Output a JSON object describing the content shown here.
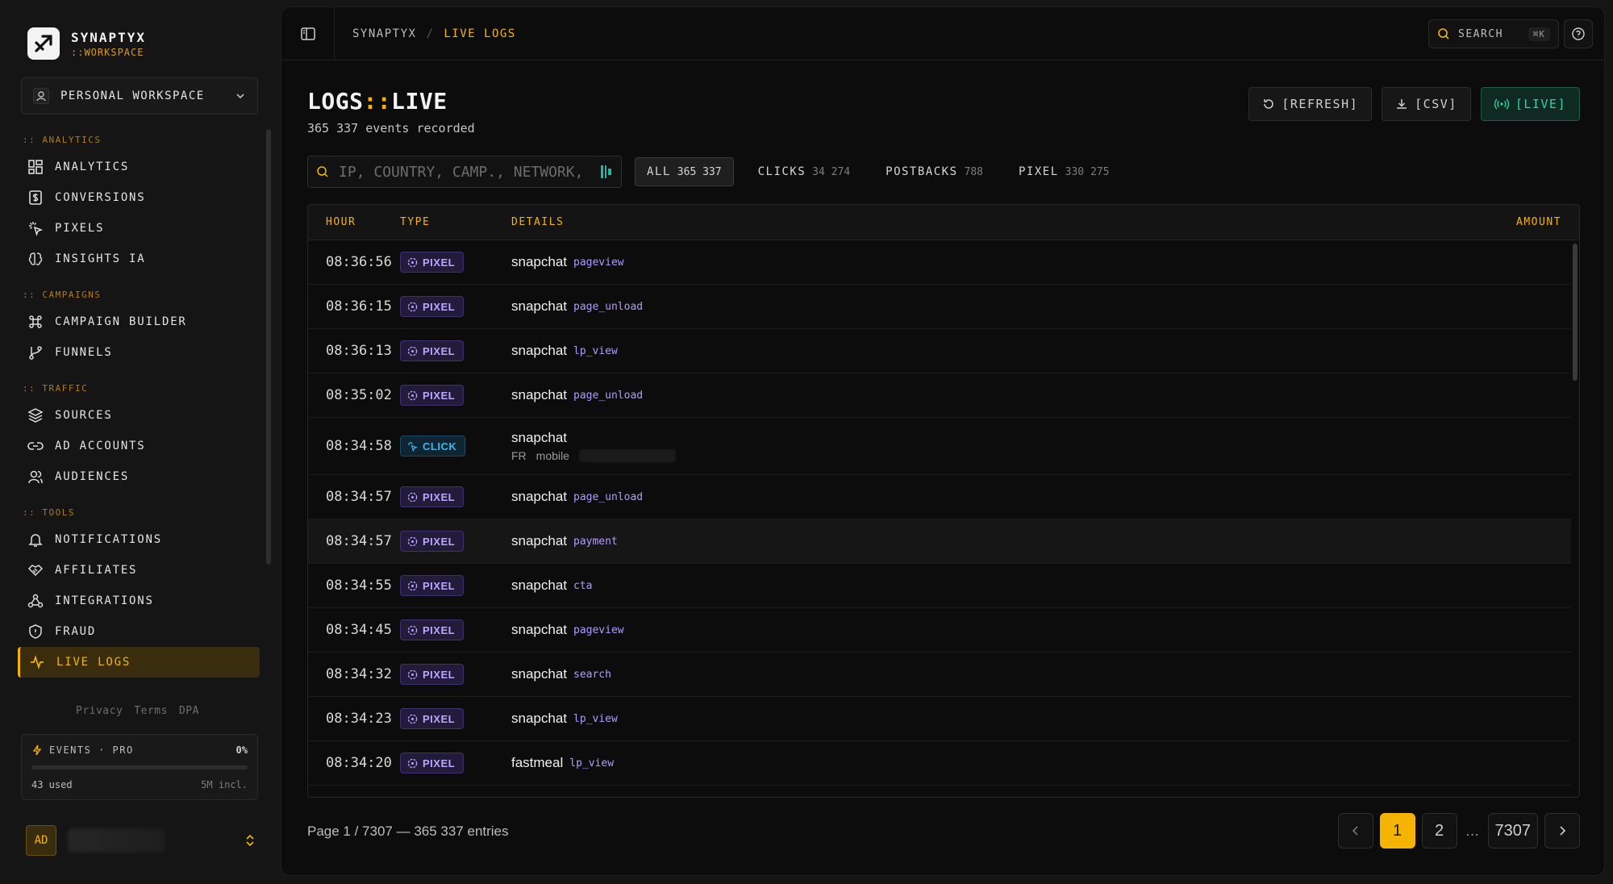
{
  "brand": {
    "name": "SYNAPTYX",
    "sub": "::WORKSPACE"
  },
  "workspace": {
    "label": "PERSONAL WORKSPACE"
  },
  "nav": {
    "analytics": {
      "title": ":: ANALYTICS",
      "items": [
        "ANALYTICS",
        "CONVERSIONS",
        "PIXELS",
        "INSIGHTS IA"
      ]
    },
    "campaigns": {
      "title": ":: CAMPAIGNS",
      "items": [
        "CAMPAIGN BUILDER",
        "FUNNELS"
      ]
    },
    "traffic": {
      "title": ":: TRAFFIC",
      "items": [
        "SOURCES",
        "AD ACCOUNTS",
        "AUDIENCES"
      ]
    },
    "tools": {
      "title": ":: TOOLS",
      "items": [
        "NOTIFICATIONS",
        "AFFILIATES",
        "INTEGRATIONS",
        "FRAUD",
        "LIVE LOGS"
      ]
    }
  },
  "legal": {
    "privacy": "Privacy",
    "terms": "Terms",
    "dpa": "DPA"
  },
  "events": {
    "label": "EVENTS · PRO",
    "percent": "0%",
    "used": "43 used",
    "included": "5M incl.",
    "usage_fraction": 0
  },
  "user": {
    "initials": "AD"
  },
  "breadcrumb": {
    "root": "SYNAPTYX",
    "sep": "/",
    "current": "LIVE LOGS"
  },
  "topbar": {
    "search_label": "SEARCH",
    "search_kbd": "⌘K"
  },
  "page": {
    "title_a": "LOGS",
    "title_sep": "::",
    "title_b": "LIVE",
    "subtitle": "365 337 events recorded"
  },
  "actions": {
    "refresh": "[REFRESH]",
    "csv": "[CSV]",
    "live": "[LIVE]"
  },
  "filter": {
    "placeholder": "IP, COUNTRY, CAMP., NETWORK, ...",
    "chips": [
      {
        "label": "ALL",
        "count": "365 337"
      },
      {
        "label": "CLICKS",
        "count": "34 274"
      },
      {
        "label": "POSTBACKS",
        "count": "788"
      },
      {
        "label": "PIXEL",
        "count": "330 275"
      }
    ]
  },
  "table": {
    "headers": {
      "hour": "HOUR",
      "type": "TYPE",
      "details": "DETAILS",
      "amount": "AMOUNT"
    },
    "rows": [
      {
        "hour": "08:36:56",
        "type": "PIXEL",
        "source": "snapchat",
        "event": "pageview"
      },
      {
        "hour": "08:36:15",
        "type": "PIXEL",
        "source": "snapchat",
        "event": "page_unload"
      },
      {
        "hour": "08:36:13",
        "type": "PIXEL",
        "source": "snapchat",
        "event": "lp_view"
      },
      {
        "hour": "08:35:02",
        "type": "PIXEL",
        "source": "snapchat",
        "event": "page_unload"
      },
      {
        "hour": "08:34:58",
        "type": "CLICK",
        "source": "snapchat",
        "country": "FR",
        "device": "mobile"
      },
      {
        "hour": "08:34:57",
        "type": "PIXEL",
        "source": "snapchat",
        "event": "page_unload"
      },
      {
        "hour": "08:34:57",
        "type": "PIXEL",
        "source": "snapchat",
        "event": "payment"
      },
      {
        "hour": "08:34:55",
        "type": "PIXEL",
        "source": "snapchat",
        "event": "cta"
      },
      {
        "hour": "08:34:45",
        "type": "PIXEL",
        "source": "snapchat",
        "event": "pageview"
      },
      {
        "hour": "08:34:32",
        "type": "PIXEL",
        "source": "snapchat",
        "event": "search"
      },
      {
        "hour": "08:34:23",
        "type": "PIXEL",
        "source": "snapchat",
        "event": "lp_view"
      },
      {
        "hour": "08:34:20",
        "type": "PIXEL",
        "source": "fastmeal",
        "event": "lp_view"
      }
    ]
  },
  "pagination": {
    "info": "Page 1 / 7307 — 365 337 entries",
    "p1": "1",
    "p2": "2",
    "ellipsis": "…",
    "last": "7307"
  },
  "colors": {
    "accent": "#f5b400",
    "pixel": "#b9a6ff",
    "click": "#36b9f0",
    "live": "#34d399"
  }
}
